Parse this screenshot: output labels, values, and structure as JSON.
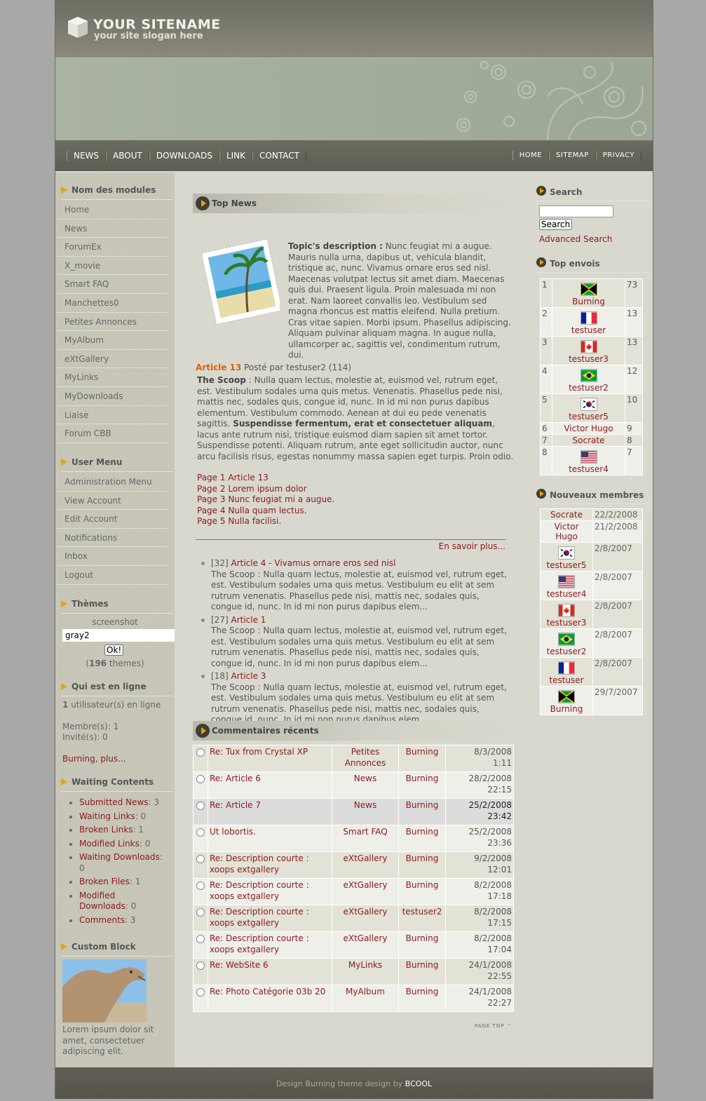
{
  "header": {
    "site_name": "YOUR SITENAME",
    "slogan": "your site slogan here"
  },
  "main_nav": [
    "NEWS",
    "ABOUT",
    "DOWNLOADS",
    "LINK",
    "CONTACT"
  ],
  "top_nav": [
    "HOME",
    "SITEMAP",
    "PRIVACY"
  ],
  "modules": {
    "title": "Nom des modules",
    "items": [
      "Home",
      "News",
      "ForumEx",
      "X_movie",
      "Smart FAQ",
      "Manchettes0",
      "Petites Annonces",
      "MyAlbum",
      "eXtGallery",
      "MyLinks",
      "MyDownloads",
      "Liaise",
      "Forum CBB"
    ]
  },
  "user_menu": {
    "title": "User Menu",
    "items": [
      "Administration Menu",
      "View Account",
      "Edit Account",
      "Notifications",
      "Inbox",
      "Logout"
    ]
  },
  "themes": {
    "title": "Thèmes",
    "label": "screenshot",
    "selected": "gray2",
    "ok": "Ok!",
    "count_prefix": "(",
    "count": "196",
    "count_suffix": " themes)"
  },
  "online": {
    "title": "Qui est en ligne",
    "count": "1",
    "count_text": " utilisateur(s) en ligne",
    "members": "Membre(s): 1",
    "guests": "Invité(s): 0",
    "link": "Burning, plus..."
  },
  "waiting": {
    "title": "Waiting Contents",
    "items": [
      {
        "label": "Submitted News",
        "value": ": 3"
      },
      {
        "label": "Waiting Links",
        "value": ": 0"
      },
      {
        "label": "Broken Links",
        "value": ": 1"
      },
      {
        "label": "Modified Links",
        "value": ": 0"
      },
      {
        "label": "Waiting Downloads",
        "value": ": 0"
      },
      {
        "label": "Broken Files",
        "value": ": 1"
      },
      {
        "label": "Modified Downloads",
        "value": ": 0"
      },
      {
        "label": "Comments",
        "value": ": 3"
      }
    ]
  },
  "custom_block": {
    "title": "Custom Block",
    "text": "Lorem ipsum dolor sit amet, consectetuer adipiscing elit."
  },
  "top_news": {
    "title": "Top News",
    "desc_label": "Topic's description :",
    "desc_text": " Nunc feugiat mi a augue. Mauris nulla urna, dapibus ut, vehicula blandit, tristique ac, nunc. Vivamus ornare eros sed nisl. Maecenas volutpat lectus sit amet diam. Maecenas quis dui. Praesent ligula. Proin malesuada mi non erat. Nam laoreet convallis leo. Vestibulum sed magna rhoncus est mattis eleifend. Nulla pretium. Cras vitae sapien. Morbi ipsum. Phasellus adipiscing. Aliquam pulvinar aliquam magna. In augue nulla, ullamcorper ac, sagittis vel, condimentum rutrum, dui.",
    "article_title": "Article 13",
    "posted_by": " Posté par testuser2 (114)",
    "scoop_label": "The Scoop",
    "scoop_text_1": " : Nulla quam lectus, molestie at, euismod vel, rutrum eget, est. Vestibulum sodales urna quis metus. Venenatis. Phasellus pede nisi, mattis nec, sodales quis, congue id, nunc. In id mi non purus dapibus elementum. Vestibulum commodo. Aenean at dui eu pede venenatis sagittis. ",
    "scoop_bold": "Suspendisse fermentum, erat et consectetuer aliquam",
    "scoop_text_2": ", lacus ante rutrum nisi, tristique euismod diam sapien sit amet tortor. Suspendisse potenti. Aliquam rutrum, ante eget sollicitudin auctor, nunc arcu facilisis risus, egestas nonummy massa sapien eget turpis. Proin odio.",
    "pages": [
      "Page 1 Article 13",
      "Page 2 Lorem ipsum dolor",
      "Page 3 Nunc feugiat mi a augue.",
      "Page 4 Nulla quam lectus.",
      "Page 5 Nulla facilisi."
    ],
    "more": "En savoir plus...",
    "list": [
      {
        "count": "[32]",
        "title": "Article 4 - Vivamus ornare eros sed nisl",
        "text": "The Scoop : Nulla quam lectus, molestie at, euismod vel, rutrum eget, est. Vestibulum sodales urna quis metus. Vestibulum eu elit at sem rutrum venenatis. Phasellus pede nisi, mattis nec, sodales quis, congue id, nunc. In id mi non purus dapibus elem..."
      },
      {
        "count": "[27]",
        "title": "Article 1",
        "text": "The Scoop : Nulla quam lectus, molestie at, euismod vel, rutrum eget, est. Vestibulum sodales urna quis metus. Vestibulum eu elit at sem rutrum venenatis. Phasellus pede nisi, mattis nec, sodales quis, congue id, nunc. In id mi non purus dapibus elem..."
      },
      {
        "count": "[18]",
        "title": "Article 3",
        "text": "The Scoop : Nulla quam lectus, molestie at, euismod vel, rutrum eget, est. Vestibulum sodales urna quis metus. Vestibulum eu elit at sem rutrum venenatis. Phasellus pede nisi, mattis nec, sodales quis, congue id, nunc. In id mi non purus dapibus elem..."
      }
    ]
  },
  "comments": {
    "title": "Commentaires récents",
    "rows": [
      {
        "title": "Re: Tux from Crystal XP",
        "module": "Petites Annonces",
        "user": "Burning",
        "date": "8/3/2008",
        "time": "1:11"
      },
      {
        "title": "Re: Article 6",
        "module": "News",
        "user": "Burning",
        "date": "28/2/2008",
        "time": "22:15"
      },
      {
        "title": "Re: Article 7",
        "module": "News",
        "user": "Burning",
        "date": "25/2/2008",
        "time": "23:42"
      },
      {
        "title": "Ut lobortis.",
        "module": "Smart FAQ",
        "user": "Burning",
        "date": "25/2/2008",
        "time": "23:36"
      },
      {
        "title": "Re: Description courte : xoops extgallery",
        "module": "eXtGallery",
        "user": "Burning",
        "date": "9/2/2008",
        "time": "12:01"
      },
      {
        "title": "Re: Description courte : xoops extgallery",
        "module": "eXtGallery",
        "user": "Burning",
        "date": "8/2/2008",
        "time": "17:18"
      },
      {
        "title": "Re: Description courte : xoops extgallery",
        "module": "eXtGallery",
        "user": "testuser2",
        "date": "8/2/2008",
        "time": "17:15"
      },
      {
        "title": "Re: Description courte : xoops extgallery",
        "module": "eXtGallery",
        "user": "Burning",
        "date": "8/2/2008",
        "time": "17:04"
      },
      {
        "title": "Re: WebSite 6",
        "module": "MyLinks",
        "user": "Burning",
        "date": "24/1/2008",
        "time": "22:55"
      },
      {
        "title": "Re: Photo Catégorie 03b 20",
        "module": "MyAlbum",
        "user": "Burning",
        "date": "24/1/2008",
        "time": "22:27"
      }
    ],
    "page_top": "PAGE TOP"
  },
  "search": {
    "title": "Search",
    "button": "Search",
    "advanced": "Advanced Search"
  },
  "top_envois": {
    "title": "Top envois",
    "rows": [
      {
        "rank": "1",
        "name": "Burning",
        "count": "73",
        "flag": "jamaica"
      },
      {
        "rank": "2",
        "name": "testuser",
        "count": "13",
        "flag": "france"
      },
      {
        "rank": "3",
        "name": "testuser3",
        "count": "13",
        "flag": "canada"
      },
      {
        "rank": "4",
        "name": "testuser2",
        "count": "12",
        "flag": "brazil"
      },
      {
        "rank": "5",
        "name": "testuser5",
        "count": "10",
        "flag": "korea"
      },
      {
        "rank": "6",
        "name": "Victor Hugo",
        "count": "9",
        "flag": ""
      },
      {
        "rank": "7",
        "name": "Socrate",
        "count": "8",
        "flag": ""
      },
      {
        "rank": "8",
        "name": "testuser4",
        "count": "7",
        "flag": "usa"
      }
    ]
  },
  "new_members": {
    "title": "Nouveaux membres",
    "rows": [
      {
        "name": "Socrate",
        "date": "22/2/2008",
        "flag": ""
      },
      {
        "name": "Victor Hugo",
        "date": "21/2/2008",
        "flag": ""
      },
      {
        "name": "testuser5",
        "date": "2/8/2007",
        "flag": "korea"
      },
      {
        "name": "testuser4",
        "date": "2/8/2007",
        "flag": "usa"
      },
      {
        "name": "testuser3",
        "date": "2/8/2007",
        "flag": "canada"
      },
      {
        "name": "testuser2",
        "date": "2/8/2007",
        "flag": "brazil"
      },
      {
        "name": "testuser",
        "date": "2/8/2007",
        "flag": "france"
      },
      {
        "name": "Burning",
        "date": "29/7/2007",
        "flag": "jamaica"
      }
    ]
  },
  "footer": {
    "text": "Design Burning theme design by ",
    "brand": "BCOOL"
  }
}
